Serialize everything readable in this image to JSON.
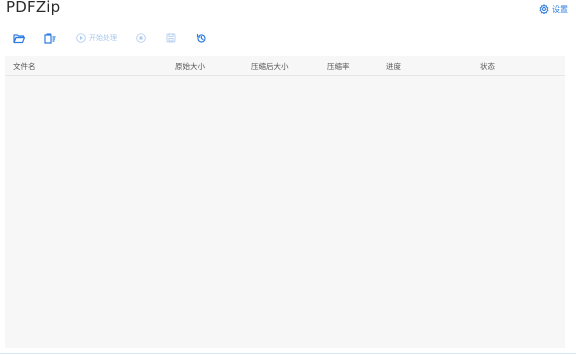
{
  "app": {
    "title": "PDFZip",
    "settings_label": "设置"
  },
  "toolbar": {
    "open_folder_icon": "folder-open-icon",
    "add_files_icon": "file-add-icon",
    "start_label": "开始处理",
    "start_icon": "play-circle-icon",
    "stop_icon": "stop-circle-icon",
    "save_icon": "save-icon",
    "history_icon": "history-icon"
  },
  "table": {
    "columns": [
      "文件名",
      "原始大小",
      "压缩后大小",
      "压缩率",
      "进度",
      "状态"
    ],
    "rows": []
  },
  "colors": {
    "accent": "#2f7de1",
    "disabled_accent": "#a9c8ef",
    "table_bg": "#f7f7f7"
  }
}
